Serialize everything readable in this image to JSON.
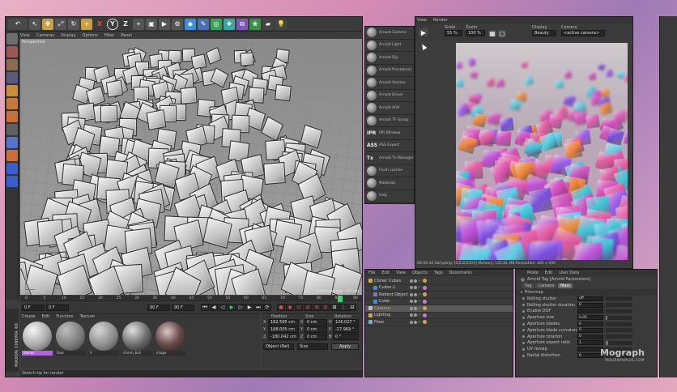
{
  "toolbar": {
    "labels": [
      "X",
      "Y",
      "Z"
    ]
  },
  "viewport": {
    "menu": [
      "View",
      "Cameras",
      "Display",
      "Options",
      "Filter",
      "Panel"
    ],
    "name": "Perspective",
    "grid_spacing": "Grid Spacing : 50 cm"
  },
  "timeline": {
    "ticks": [
      "0",
      "5",
      "10",
      "15",
      "20",
      "25",
      "30",
      "35",
      "40",
      "45",
      "50",
      "55",
      "60",
      "65",
      "70",
      "75",
      "80",
      "85",
      "90"
    ],
    "start": "0 F",
    "current": "0 F",
    "end": "90 F",
    "end2": "90 F",
    "frame": "90 F"
  },
  "material_manager": {
    "menu": [
      "Create",
      "Edit",
      "Function",
      "Texture"
    ],
    "materials": [
      {
        "name": "stones",
        "selected": true
      },
      {
        "name": "floor",
        "selected": false
      },
      {
        "name": "S",
        "selected": false
      },
      {
        "name": "chrom_ball",
        "selected": false
      },
      {
        "name": "image",
        "selected": false
      }
    ]
  },
  "coordinates": {
    "headers": [
      "Position",
      "Size",
      "Rotation"
    ],
    "rows": [
      {
        "axis": "X",
        "pos": "182.595 cm",
        "size": "0 cm",
        "rot_axis": "H",
        "rot": "126.027 °"
      },
      {
        "axis": "Y",
        "pos": "168.005 cm",
        "size": "0 cm",
        "rot_axis": "P",
        "rot": "-27.969 °"
      },
      {
        "axis": "Z",
        "pos": "-180.042 cm",
        "size": "0 cm",
        "rot_axis": "B",
        "rot": "0 °"
      }
    ],
    "mode": "Object (Rel)",
    "size_mode": "Size",
    "apply": "Apply"
  },
  "status": "Sketch tip for render",
  "render_view": {
    "title_items": [
      "View",
      "Render"
    ],
    "scale_label": "Scale",
    "scale_value": "55 %",
    "zoom_label": "Zoom",
    "zoom_value": "100 %",
    "display_label": "Display",
    "display_value": "Beauty",
    "camera_label": "Camera",
    "camera_value": "<active camera>",
    "status_line": "00:00:42  Sampling: [3/2/2/2/2/2]  Memory: 145.81 MB  Resolution: 405 x 440"
  },
  "arnold_menu": {
    "items": [
      "Arnold Camera",
      "Arnold Light",
      "Arnold Sky",
      "Arnold Procedural",
      "Arnold Volume",
      "Arnold Driver",
      "Arnold AOV",
      "Arnold TF Group",
      "IPR Window",
      "ASS Export",
      "Arnold Tx Manager",
      "Flush caches",
      "Materials",
      "Help"
    ],
    "icon_text": [
      "",
      "",
      "",
      "",
      "",
      "",
      "",
      "",
      "IPR",
      "ASS",
      "Tx",
      "",
      "",
      ""
    ]
  },
  "object_manager": {
    "menu": [
      "File",
      "Edit",
      "View",
      "Objects",
      "Tags",
      "Bookmarks"
    ],
    "objects": [
      "Cloner Cubes",
      "Cubes.1",
      "Rodent Object",
      "Cube",
      "Camera",
      "Lighting",
      "Floor"
    ]
  },
  "attribute_manager": {
    "menu": [
      "Mode",
      "Edit",
      "User Data"
    ],
    "title": "Arnold Tag [Arnold Parameters]",
    "tabs": [
      "Tag",
      "Camera",
      "Main"
    ],
    "section": "Filtermap",
    "rows": [
      {
        "label": "Rolling shutter",
        "value": "off",
        "fill": 0
      },
      {
        "label": "Rolling shutter duration",
        "value": "0",
        "fill": 0
      },
      {
        "label": "Enable DOF",
        "value": "",
        "fill": 0
      },
      {
        "label": "Aperture size",
        "value": "0.05",
        "fill": 0.05
      },
      {
        "label": "Aperture blades",
        "value": "0",
        "fill": 0
      },
      {
        "label": "Aperture blade curvature",
        "value": "0",
        "fill": 0
      },
      {
        "label": "Aperture rotation",
        "value": "0",
        "fill": 0
      },
      {
        "label": "Aperture aspect ratio",
        "value": "1",
        "fill": 0.1
      },
      {
        "label": "UV remap",
        "value": "",
        "fill": 0
      },
      {
        "label": "Radial distortion",
        "value": "0",
        "fill": 0
      }
    ]
  },
  "watermark": {
    "brand": "Mograph",
    "sub": "MOGRAPHPLUS.COM"
  },
  "maxon_logo": "MAXON CINEMA 4D",
  "colors": {
    "accent": "#b066e0",
    "selected_row": "#5a5a5a",
    "panel": "#3a3a3a",
    "desktop": "#d48bb3"
  }
}
